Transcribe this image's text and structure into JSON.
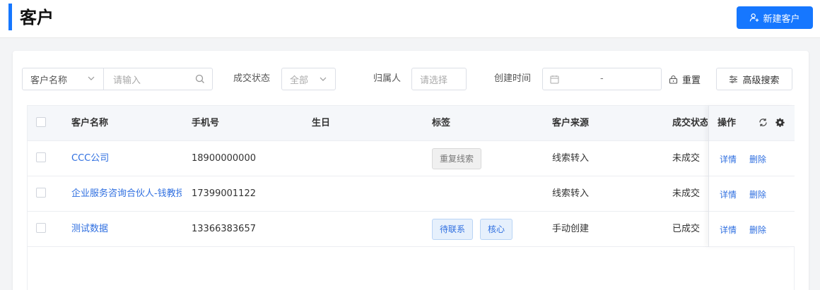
{
  "header": {
    "title": "客户",
    "new_button": "新建客户"
  },
  "filters": {
    "field_select": "客户名称",
    "keyword_placeholder": "请输入",
    "status_label": "成交状态",
    "status_value": "全部",
    "owner_label": "归属人",
    "owner_placeholder": "请选择",
    "created_label": "创建时间",
    "date_separator": "-",
    "reset": "重置",
    "advanced": "高级搜索"
  },
  "table": {
    "columns": [
      "客户名称",
      "手机号",
      "生日",
      "标签",
      "客户来源",
      "成交状态"
    ],
    "ops_header": "操作",
    "rows": [
      {
        "name": "CCC公司",
        "phone": "18900000000",
        "birthday": "",
        "tags": [
          {
            "text": "重复线索",
            "style": "gray"
          }
        ],
        "source": "线索转入",
        "status": "未成交",
        "op_detail": "详情",
        "op_delete": "删除"
      },
      {
        "name": "企业服务咨询合伙人-钱教授",
        "phone": "17399001122",
        "birthday": "",
        "tags": [],
        "source": "线索转入",
        "status": "未成交",
        "op_detail": "详情",
        "op_delete": "删除"
      },
      {
        "name": "测试数据",
        "phone": "13366383657",
        "birthday": "",
        "tags": [
          {
            "text": "待联系",
            "style": "blue"
          },
          {
            "text": "核心",
            "style": "blue"
          }
        ],
        "source": "手动创建",
        "status": "已成交",
        "op_detail": "详情",
        "op_delete": "删除"
      }
    ]
  },
  "icons": {
    "new_button": "user-add-icon",
    "search": "search-icon",
    "dropdown": "chevron-down-icon",
    "date": "calendar-icon",
    "reset": "lock-reset-icon",
    "advanced": "sliders-icon",
    "refresh": "refresh-icon",
    "settings": "gear-icon"
  },
  "colors": {
    "primary": "#1677ff",
    "link": "#2f6fe0",
    "header_bg": "#f5f7fa"
  }
}
